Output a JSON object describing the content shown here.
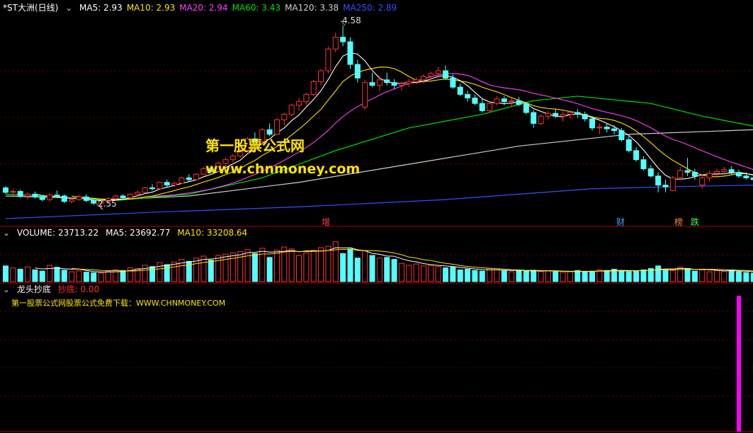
{
  "price_panel": {
    "title": "*ST大洲(日线)",
    "ma_labels": [
      {
        "label": "MA5: 2.93",
        "color": "#ffffff"
      },
      {
        "label": "MA10: 2.93",
        "color": "#ffe400"
      },
      {
        "label": "MA20: 2.94",
        "color": "#ff40ff"
      },
      {
        "label": "MA60: 3.43",
        "color": "#00e000"
      },
      {
        "label": "MA120: 3.38",
        "color": "#cfcfcf"
      },
      {
        "label": "MA250: 2.89",
        "color": "#3050ff"
      }
    ],
    "high_label": "4.58",
    "low_label": "2.55",
    "markers": [
      {
        "text": "增",
        "color": "#ff4040"
      },
      {
        "text": "财",
        "color": "#40a0ff"
      },
      {
        "text": "榜",
        "color": "#ff8040"
      },
      {
        "text": "跌",
        "color": "#40ff40"
      }
    ]
  },
  "volume_panel": {
    "title": "VOLUME: 23713.22",
    "ma5": "MA5: 23692.77",
    "ma10": "MA10: 33208.64"
  },
  "indicator_panel": {
    "title": "龙头抄底",
    "value": "抄底: 0.00",
    "download_text": "第一股票公式网股票公式免费下载：WWW.CHNMONEY.COM"
  },
  "watermark": {
    "line1": "第一股票公式网",
    "line2": "www.chnmoney.com"
  },
  "colors": {
    "up": "#ff3232",
    "down": "#54ffff",
    "grid": "#8b0000",
    "signal": "#ff00ff"
  },
  "chart_data": {
    "type": "candlestick",
    "price_range": [
      2.38,
      4.72
    ],
    "prices": [
      {
        "o": 2.79,
        "h": 2.81,
        "l": 2.72,
        "c": 2.74
      },
      {
        "o": 2.74,
        "h": 2.78,
        "l": 2.7,
        "c": 2.75
      },
      {
        "o": 2.75,
        "h": 2.77,
        "l": 2.68,
        "c": 2.7
      },
      {
        "o": 2.7,
        "h": 2.74,
        "l": 2.66,
        "c": 2.72
      },
      {
        "o": 2.72,
        "h": 2.75,
        "l": 2.67,
        "c": 2.69
      },
      {
        "o": 2.69,
        "h": 2.71,
        "l": 2.64,
        "c": 2.66
      },
      {
        "o": 2.66,
        "h": 2.73,
        "l": 2.64,
        "c": 2.71
      },
      {
        "o": 2.71,
        "h": 2.76,
        "l": 2.68,
        "c": 2.7
      },
      {
        "o": 2.7,
        "h": 2.72,
        "l": 2.62,
        "c": 2.64
      },
      {
        "o": 2.64,
        "h": 2.68,
        "l": 2.62,
        "c": 2.66
      },
      {
        "o": 2.66,
        "h": 2.71,
        "l": 2.65,
        "c": 2.69
      },
      {
        "o": 2.69,
        "h": 2.72,
        "l": 2.63,
        "c": 2.65
      },
      {
        "o": 2.65,
        "h": 2.67,
        "l": 2.6,
        "c": 2.62
      },
      {
        "o": 2.62,
        "h": 2.66,
        "l": 2.55,
        "c": 2.64
      },
      {
        "o": 2.64,
        "h": 2.69,
        "l": 2.62,
        "c": 2.67
      },
      {
        "o": 2.67,
        "h": 2.71,
        "l": 2.65,
        "c": 2.7
      },
      {
        "o": 2.7,
        "h": 2.72,
        "l": 2.66,
        "c": 2.68
      },
      {
        "o": 2.68,
        "h": 2.73,
        "l": 2.67,
        "c": 2.72
      },
      {
        "o": 2.72,
        "h": 2.76,
        "l": 2.7,
        "c": 2.74
      },
      {
        "o": 2.74,
        "h": 2.8,
        "l": 2.73,
        "c": 2.79
      },
      {
        "o": 2.79,
        "h": 2.83,
        "l": 2.76,
        "c": 2.78
      },
      {
        "o": 2.78,
        "h": 2.86,
        "l": 2.77,
        "c": 2.85
      },
      {
        "o": 2.85,
        "h": 2.88,
        "l": 2.8,
        "c": 2.82
      },
      {
        "o": 2.82,
        "h": 2.86,
        "l": 2.8,
        "c": 2.84
      },
      {
        "o": 2.84,
        "h": 2.91,
        "l": 2.83,
        "c": 2.9
      },
      {
        "o": 2.9,
        "h": 2.94,
        "l": 2.86,
        "c": 2.88
      },
      {
        "o": 2.88,
        "h": 2.95,
        "l": 2.87,
        "c": 2.94
      },
      {
        "o": 2.94,
        "h": 3.02,
        "l": 2.93,
        "c": 3.0
      },
      {
        "o": 3.0,
        "h": 3.03,
        "l": 2.95,
        "c": 2.97
      },
      {
        "o": 2.97,
        "h": 3.08,
        "l": 2.96,
        "c": 3.06
      },
      {
        "o": 3.06,
        "h": 3.12,
        "l": 3.03,
        "c": 3.1
      },
      {
        "o": 3.1,
        "h": 3.16,
        "l": 3.07,
        "c": 3.14
      },
      {
        "o": 3.14,
        "h": 3.22,
        "l": 3.12,
        "c": 3.2
      },
      {
        "o": 3.2,
        "h": 3.35,
        "l": 3.18,
        "c": 3.33
      },
      {
        "o": 3.33,
        "h": 3.4,
        "l": 3.26,
        "c": 3.3
      },
      {
        "o": 3.3,
        "h": 3.45,
        "l": 3.28,
        "c": 3.43
      },
      {
        "o": 3.43,
        "h": 3.5,
        "l": 3.36,
        "c": 3.38
      },
      {
        "o": 3.38,
        "h": 3.56,
        "l": 3.37,
        "c": 3.54
      },
      {
        "o": 3.54,
        "h": 3.62,
        "l": 3.48,
        "c": 3.6
      },
      {
        "o": 3.6,
        "h": 3.72,
        "l": 3.58,
        "c": 3.7
      },
      {
        "o": 3.7,
        "h": 3.78,
        "l": 3.64,
        "c": 3.74
      },
      {
        "o": 3.74,
        "h": 3.84,
        "l": 3.7,
        "c": 3.82
      },
      {
        "o": 3.82,
        "h": 3.98,
        "l": 3.8,
        "c": 3.96
      },
      {
        "o": 3.96,
        "h": 4.1,
        "l": 3.92,
        "c": 4.08
      },
      {
        "o": 4.08,
        "h": 4.35,
        "l": 4.05,
        "c": 4.32
      },
      {
        "o": 4.32,
        "h": 4.5,
        "l": 4.28,
        "c": 4.45
      },
      {
        "o": 4.45,
        "h": 4.58,
        "l": 4.35,
        "c": 4.4
      },
      {
        "o": 4.4,
        "h": 4.45,
        "l": 4.1,
        "c": 4.15
      },
      {
        "o": 4.15,
        "h": 4.2,
        "l": 3.95,
        "c": 4.0
      },
      {
        "o": 3.68,
        "h": 3.98,
        "l": 3.65,
        "c": 3.95
      },
      {
        "o": 3.95,
        "h": 4.06,
        "l": 3.9,
        "c": 3.92
      },
      {
        "o": 3.92,
        "h": 4.02,
        "l": 3.86,
        "c": 3.98
      },
      {
        "o": 3.98,
        "h": 4.06,
        "l": 3.92,
        "c": 3.95
      },
      {
        "o": 3.95,
        "h": 3.99,
        "l": 3.88,
        "c": 3.92
      },
      {
        "o": 3.92,
        "h": 3.96,
        "l": 3.86,
        "c": 3.94
      },
      {
        "o": 3.94,
        "h": 3.99,
        "l": 3.9,
        "c": 3.96
      },
      {
        "o": 3.96,
        "h": 4.01,
        "l": 3.93,
        "c": 3.98
      },
      {
        "o": 3.98,
        "h": 4.04,
        "l": 3.94,
        "c": 4.02
      },
      {
        "o": 4.02,
        "h": 4.07,
        "l": 3.98,
        "c": 4.05
      },
      {
        "o": 4.05,
        "h": 4.12,
        "l": 4.0,
        "c": 4.08
      },
      {
        "o": 4.08,
        "h": 4.14,
        "l": 3.98,
        "c": 4.0
      },
      {
        "o": 4.0,
        "h": 4.04,
        "l": 3.88,
        "c": 3.9
      },
      {
        "o": 3.9,
        "h": 3.94,
        "l": 3.8,
        "c": 3.82
      },
      {
        "o": 3.82,
        "h": 3.86,
        "l": 3.74,
        "c": 3.78
      },
      {
        "o": 3.78,
        "h": 3.82,
        "l": 3.7,
        "c": 3.72
      },
      {
        "o": 3.72,
        "h": 3.78,
        "l": 3.62,
        "c": 3.64
      },
      {
        "o": 3.64,
        "h": 3.74,
        "l": 3.62,
        "c": 3.72
      },
      {
        "o": 3.72,
        "h": 3.8,
        "l": 3.7,
        "c": 3.77
      },
      {
        "o": 3.77,
        "h": 3.8,
        "l": 3.7,
        "c": 3.74
      },
      {
        "o": 3.74,
        "h": 3.78,
        "l": 3.68,
        "c": 3.75
      },
      {
        "o": 3.75,
        "h": 3.79,
        "l": 3.69,
        "c": 3.71
      },
      {
        "o": 3.71,
        "h": 3.74,
        "l": 3.6,
        "c": 3.62
      },
      {
        "o": 3.62,
        "h": 3.65,
        "l": 3.45,
        "c": 3.5
      },
      {
        "o": 3.5,
        "h": 3.6,
        "l": 3.48,
        "c": 3.58
      },
      {
        "o": 3.58,
        "h": 3.64,
        "l": 3.54,
        "c": 3.61
      },
      {
        "o": 3.61,
        "h": 3.66,
        "l": 3.56,
        "c": 3.58
      },
      {
        "o": 3.58,
        "h": 3.63,
        "l": 3.52,
        "c": 3.6
      },
      {
        "o": 3.6,
        "h": 3.64,
        "l": 3.55,
        "c": 3.62
      },
      {
        "o": 3.62,
        "h": 3.66,
        "l": 3.56,
        "c": 3.6
      },
      {
        "o": 3.6,
        "h": 3.63,
        "l": 3.52,
        "c": 3.55
      },
      {
        "o": 3.55,
        "h": 3.58,
        "l": 3.42,
        "c": 3.45
      },
      {
        "o": 3.45,
        "h": 3.5,
        "l": 3.38,
        "c": 3.46
      },
      {
        "o": 3.46,
        "h": 3.5,
        "l": 3.4,
        "c": 3.44
      },
      {
        "o": 3.44,
        "h": 3.48,
        "l": 3.38,
        "c": 3.42
      },
      {
        "o": 3.42,
        "h": 3.45,
        "l": 3.3,
        "c": 3.32
      },
      {
        "o": 3.32,
        "h": 3.36,
        "l": 3.18,
        "c": 3.2
      },
      {
        "o": 3.2,
        "h": 3.24,
        "l": 3.08,
        "c": 3.1
      },
      {
        "o": 3.1,
        "h": 3.14,
        "l": 2.98,
        "c": 3.0
      },
      {
        "o": 3.0,
        "h": 3.04,
        "l": 2.9,
        "c": 2.92
      },
      {
        "o": 2.92,
        "h": 2.96,
        "l": 2.74,
        "c": 2.82
      },
      {
        "o": 2.82,
        "h": 2.88,
        "l": 2.74,
        "c": 2.8
      },
      {
        "o": 2.76,
        "h": 2.92,
        "l": 2.75,
        "c": 2.9
      },
      {
        "o": 2.9,
        "h": 3.02,
        "l": 2.88,
        "c": 2.98
      },
      {
        "o": 2.98,
        "h": 3.12,
        "l": 2.92,
        "c": 2.96
      },
      {
        "o": 2.96,
        "h": 3.0,
        "l": 2.88,
        "c": 2.92
      },
      {
        "o": 2.82,
        "h": 2.94,
        "l": 2.78,
        "c": 2.9
      },
      {
        "o": 2.9,
        "h": 2.98,
        "l": 2.86,
        "c": 2.95
      },
      {
        "o": 2.95,
        "h": 3.0,
        "l": 2.9,
        "c": 2.97
      },
      {
        "o": 2.97,
        "h": 3.02,
        "l": 2.92,
        "c": 2.99
      },
      {
        "o": 2.99,
        "h": 3.03,
        "l": 2.94,
        "c": 2.96
      },
      {
        "o": 2.96,
        "h": 2.99,
        "l": 2.9,
        "c": 2.92
      },
      {
        "o": 2.92,
        "h": 2.96,
        "l": 2.88,
        "c": 2.9
      },
      {
        "o": 2.9,
        "h": 2.94,
        "l": 2.86,
        "c": 2.88
      }
    ],
    "volume": [
      4.8,
      4.2,
      3.8,
      4.5,
      3.6,
      3.2,
      5.0,
      4.4,
      3.5,
      3.0,
      3.3,
      2.9,
      2.7,
      2.6,
      3.2,
      3.6,
      3.4,
      4.2,
      4.0,
      5.0,
      4.6,
      5.8,
      5.2,
      6.0,
      6.8,
      6.2,
      7.2,
      7.8,
      6.6,
      8.0,
      8.4,
      8.8,
      9.2,
      9.8,
      8.6,
      10.2,
      7.4,
      9.6,
      10.6,
      10.0,
      8.0,
      8.8,
      9.6,
      10.4,
      10.8,
      12.2,
      8.6,
      10.0,
      7.2,
      9.4,
      8.0,
      7.2,
      7.4,
      6.8,
      5.6,
      5.0,
      5.4,
      4.8,
      5.0,
      4.6,
      4.2,
      4.4,
      3.6,
      3.8,
      3.4,
      3.2,
      4.0,
      3.6,
      3.3,
      3.0,
      3.4,
      3.2,
      3.5,
      3.1,
      3.3,
      3.0,
      2.8,
      3.1,
      3.4,
      3.0,
      3.2,
      3.6,
      3.4,
      3.8,
      3.2,
      3.0,
      3.3,
      3.6,
      4.0,
      4.8,
      3.6,
      3.4,
      4.4,
      4.0,
      3.2,
      3.6,
      3.0,
      3.4,
      3.2,
      3.6,
      3.0,
      2.8,
      2.6
    ],
    "volume_max": 13,
    "signal_index": 100
  }
}
